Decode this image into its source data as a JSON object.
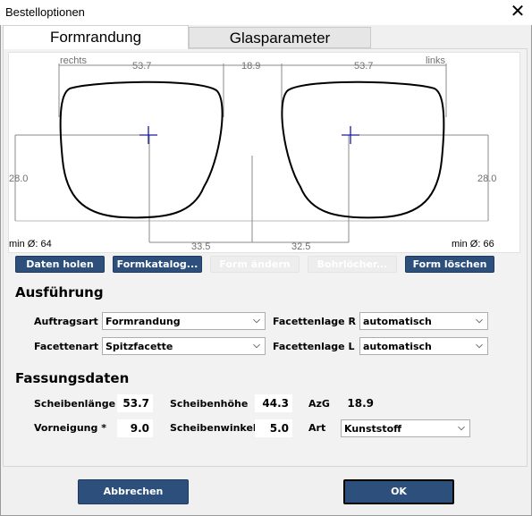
{
  "window": {
    "title": "Bestelloptionen",
    "close_glyph": "✕"
  },
  "tabs": [
    {
      "label": "Formrandung",
      "active": true
    },
    {
      "label": "Glasparameter",
      "active": false
    }
  ],
  "drawing": {
    "right_label": "rechts",
    "left_label": "links",
    "width_right": "53.7",
    "bridge": "18.9",
    "width_left": "53.7",
    "height_right": "28.0",
    "height_left": "28.0",
    "pd_right": "33.5",
    "pd_left": "32.5",
    "min_dia_right": "min Ø: 64",
    "min_dia_left": "min Ø: 66"
  },
  "shape_buttons": {
    "daten_holen": "Daten holen",
    "formkatalog": "Formkatalog...",
    "form_aendern": "Form ändern",
    "bohrloecher": "Bohrlöcher...",
    "form_loeschen": "Form löschen"
  },
  "ausfuehrung": {
    "title": "Ausführung",
    "auftragsart_label": "Auftragsart",
    "auftragsart_value": "Formrandung",
    "facettenart_label": "Facettenart",
    "facettenart_value": "Spitzfacette",
    "facettenlage_r_label": "Facettenlage R",
    "facettenlage_r_value": "automatisch",
    "facettenlage_l_label": "Facettenlage L",
    "facettenlage_l_value": "automatisch"
  },
  "fassungsdaten": {
    "title": "Fassungsdaten",
    "scheibenlaenge_label": "Scheibenlänge",
    "scheibenlaenge_value": "53.7",
    "scheibenhoehe_label": "Scheibenhöhe",
    "scheibenhoehe_value": "44.3",
    "azg_label": "AzG",
    "azg_value": "18.9",
    "vorneigung_label": "Vorneigung *",
    "vorneigung_value": "9.0",
    "scheibenwinkel_label": "Scheibenwinkel",
    "scheibenwinkel_value": "5.0",
    "art_label": "Art",
    "art_value": "Kunststoff"
  },
  "footer": {
    "cancel_label": "Abbrechen",
    "ok_label": "OK"
  },
  "colors": {
    "button_blue": "#2d4f7b",
    "crosshair": "#1a1aa0"
  }
}
